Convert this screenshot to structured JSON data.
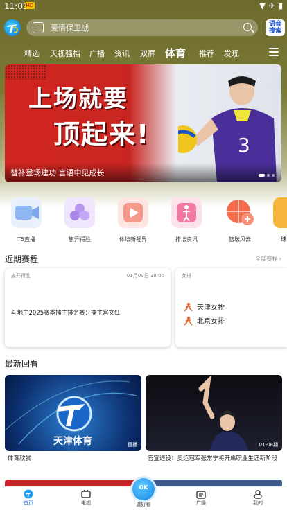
{
  "status_bar": {
    "time": "11:09",
    "badge": "HD"
  },
  "header": {
    "search_placeholder": "爱情保卫战",
    "search_button": "搜索",
    "search_button_prefix": "语音"
  },
  "nav": {
    "tabs": [
      "精选",
      "天视强档",
      "广播",
      "资讯",
      "双屏",
      "体育",
      "推荐",
      "发现"
    ],
    "active": "体育"
  },
  "banner": {
    "headline_1": "上场就要",
    "headline_2": "顶起来!",
    "caption": "替补登场建功 言语中见成长",
    "jersey_number": "3",
    "page_count": 3,
    "current_page": 1
  },
  "quick_links": [
    {
      "label": "T5直播",
      "icon": "video-camera-icon",
      "color": "#8fb8f3"
    },
    {
      "label": "旗开得胜",
      "icon": "flower-icon",
      "color": "#b897f0"
    },
    {
      "label": "体坛新视界",
      "icon": "play-icon",
      "color": "#f59a8a"
    },
    {
      "label": "排坛资讯",
      "icon": "volleyball-player-icon",
      "color": "#f27aa0"
    },
    {
      "label": "篮坛风云",
      "icon": "basketball-plus-icon",
      "color": "#f36b4a"
    },
    {
      "label": "球",
      "icon": "partial-icon",
      "color": "#f5b53a"
    }
  ],
  "recent_matches": {
    "title": "近期赛程",
    "more": "全部赛程 ›",
    "cards": [
      {
        "tag": "旗开得胜",
        "date": "01月09日 18:00",
        "text": "斗地主2025赛季擂主排名赛：擂主宫文红"
      },
      {
        "tag": "女排",
        "teams": [
          "天津女排",
          "北京女排"
        ]
      }
    ]
  },
  "replays": {
    "title": "最新回看",
    "items": [
      {
        "caption": "体育欣赏",
        "corner": "直播",
        "logo_text": "天津体育",
        "logo_num": "5"
      },
      {
        "caption": "官宣退役！奥运冠军张常宁将开启职业生涯新阶段",
        "corner": "01-08期"
      }
    ]
  },
  "tabbar": {
    "tabs": [
      {
        "label": "首页",
        "icon": "home-icon",
        "active": true
      },
      {
        "label": "电视",
        "icon": "tv-icon",
        "active": false
      },
      {
        "label": "选好看",
        "icon": "ok-icon",
        "active": false
      },
      {
        "label": "广播",
        "icon": "radio-icon",
        "active": false
      },
      {
        "label": "我的",
        "icon": "profile-icon",
        "active": false
      }
    ],
    "fab_text": "OK"
  },
  "colors": {
    "accent": "#1a6fe0",
    "header_bg": "#6d6a2e",
    "banner_red": "#d12520"
  }
}
